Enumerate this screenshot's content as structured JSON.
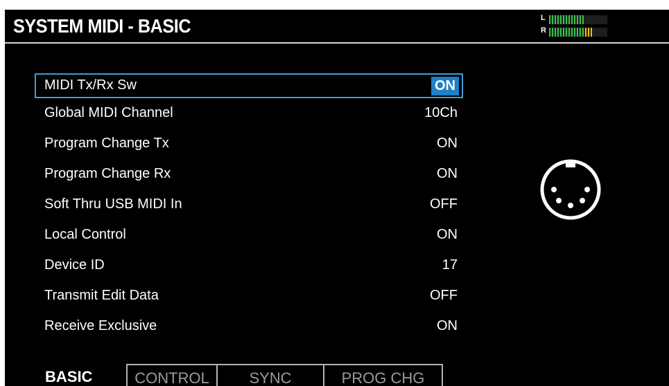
{
  "screen": {
    "title": "SYSTEM MIDI - BASIC",
    "meter": {
      "left_label": "L",
      "right_label": "R",
      "left_level": 0.6,
      "right_level": 0.78
    }
  },
  "params": [
    {
      "label": "MIDI Tx/Rx Sw",
      "value": "ON",
      "selected": true
    },
    {
      "label": "Global MIDI Channel",
      "value": "10Ch"
    },
    {
      "label": "Program Change Tx",
      "value": "ON"
    },
    {
      "label": "Program Change Rx",
      "value": "ON"
    },
    {
      "label": "Soft Thru USB MIDI In",
      "value": "OFF"
    },
    {
      "label": "Local Control",
      "value": "ON"
    },
    {
      "label": "Device ID",
      "value": "17"
    },
    {
      "label": "Transmit Edit Data",
      "value": "OFF"
    },
    {
      "label": "Receive Exclusive",
      "value": "ON"
    }
  ],
  "tabs": [
    {
      "label": "BASIC",
      "active": true
    },
    {
      "label": "CONTROL"
    },
    {
      "label": "SYNC"
    },
    {
      "label": "PROG CHG"
    }
  ],
  "icons": {
    "connector": "midi-connector-icon"
  },
  "colors": {
    "accent": "#1f7fc7",
    "selection_border": "#3f9fd6",
    "meter_green": "#35c44a",
    "meter_yellow": "#f2c200"
  }
}
